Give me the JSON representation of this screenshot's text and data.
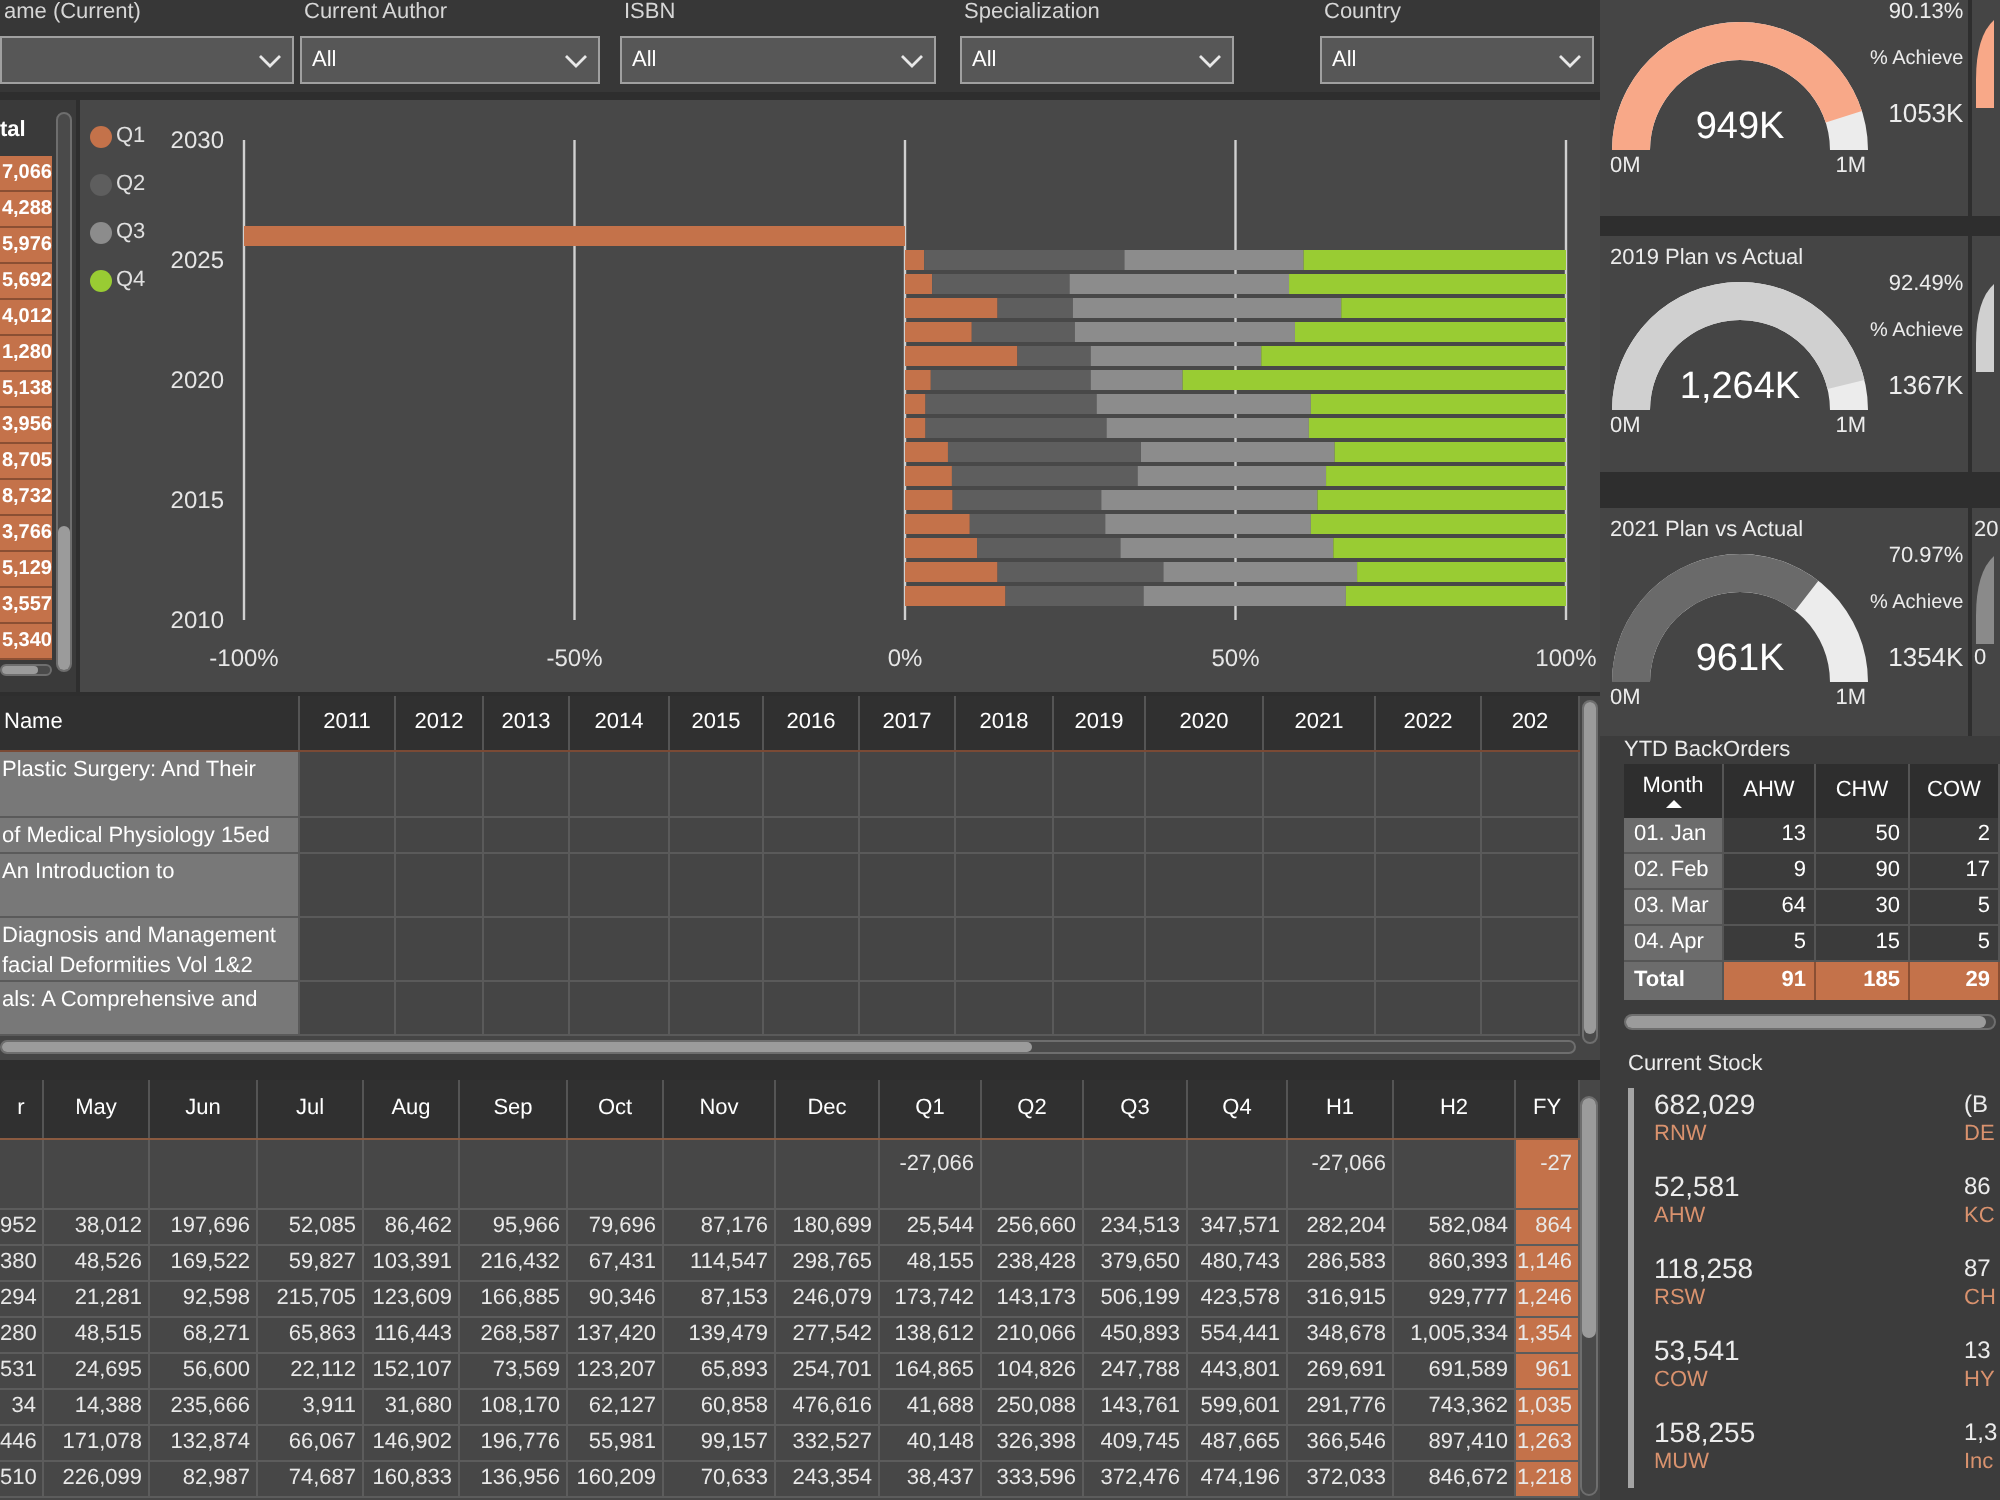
{
  "filters": [
    {
      "label": "ame (Current)"
    },
    {
      "label": "Current Author",
      "value": "All"
    },
    {
      "label": "ISBN",
      "value": "All"
    },
    {
      "label": "Specialization",
      "value": "All"
    },
    {
      "label": "Country",
      "value": "All"
    }
  ],
  "total_column": {
    "header": "tal",
    "values": [
      "7,066",
      "4,288",
      "5,976",
      "5,692",
      "4,012",
      "1,280",
      "5,138",
      "3,956",
      "8,705",
      "8,732",
      "3,766",
      "5,129",
      "3,557",
      "5,340"
    ]
  },
  "quarter_chart": {
    "chart_data": {
      "type": "bar",
      "orientation": "horizontal",
      "stacked": true,
      "grid": true,
      "x": [
        2011,
        2012,
        2013,
        2014,
        2015,
        2016,
        2017,
        2018,
        2019,
        2020,
        2021,
        2022,
        2023,
        2024,
        2025,
        2026
      ],
      "xlim": [
        -100,
        100
      ],
      "xticks": [
        {
          "value": -100,
          "label": "-100%"
        },
        {
          "value": -50,
          "label": "-50%"
        },
        {
          "value": 0,
          "label": "0%"
        },
        {
          "value": 50,
          "label": "50%"
        },
        {
          "value": 100,
          "label": "100%"
        }
      ],
      "ylim": [
        2010,
        2030
      ],
      "yticks": [
        2010,
        2015,
        2020,
        2025,
        2030
      ],
      "series": [
        {
          "name": "Q1",
          "color": "#c4724a",
          "values": [
            15.2,
            14.0,
            10.9,
            9.8,
            7.2,
            7.1,
            6.5,
            3.1,
            3.1,
            3.9,
            17.0,
            10.1,
            14.0,
            4.1,
            2.9,
            -100
          ]
        },
        {
          "name": "Q2",
          "color": "#5e5e5e",
          "values": [
            20.9,
            25.1,
            21.7,
            20.5,
            22.5,
            28.1,
            29.2,
            27.4,
            25.9,
            24.2,
            11.1,
            15.6,
            11.4,
            20.8,
            30.3,
            null
          ]
        },
        {
          "name": "Q3",
          "color": "#8c8c8c",
          "values": [
            30.6,
            29.3,
            32.2,
            31.1,
            32.7,
            28.5,
            29.3,
            30.6,
            32.4,
            13.9,
            25.8,
            33.3,
            40.6,
            33.2,
            27.1,
            null
          ]
        },
        {
          "name": "Q4",
          "color": "#99cc33",
          "values": [
            33.3,
            31.6,
            35.2,
            38.6,
            37.6,
            36.3,
            35.0,
            38.9,
            38.6,
            58.0,
            46.1,
            41.0,
            34.0,
            41.9,
            39.7,
            null
          ]
        }
      ]
    }
  },
  "gauges": [
    {
      "percent": "90.13%",
      "percent_label": "% Achieve",
      "value": "949K",
      "target": "1053K",
      "min": "0M",
      "max": "1M",
      "color": "#f8a888"
    },
    {
      "title": "2019 Plan vs Actual",
      "percent": "92.49%",
      "percent_label": "% Achieve",
      "value": "1,264K",
      "target": "1367K",
      "min": "0M",
      "max": "1M",
      "color": "#d0d0d0"
    },
    {
      "title": "2021 Plan vs Actual",
      "percent": "70.97%",
      "percent_label": "% Achieve",
      "value": "961K",
      "target": "1354K",
      "min": "0M",
      "max": "1M",
      "color": "#6a6a6a"
    }
  ],
  "edge_panels": [
    {
      "kind": "gauge",
      "color": "#f8a888"
    },
    {
      "kind": "gauge",
      "color": "#d0d0d0"
    },
    {
      "kind": "gauge",
      "title": "20",
      "min": "0",
      "color": "#8a8a8a"
    }
  ],
  "books_table": {
    "columns": [
      "Name",
      "2011",
      "2012",
      "2013",
      "2014",
      "2015",
      "2016",
      "2017",
      "2018",
      "2019",
      "2020",
      "2021",
      "2022",
      "202"
    ],
    "rows": [
      {
        "lines": [
          "Plastic Surgery: And Their"
        ]
      },
      {
        "lines": [
          "of Medical Physiology 15ed"
        ]
      },
      {
        "lines": [
          "An Introduction to"
        ]
      },
      {
        "lines": [
          "Diagnosis and Management",
          "facial Deformities Vol 1&2"
        ]
      },
      {
        "lines": [
          "als: A Comprehensive and"
        ]
      }
    ]
  },
  "monthly_table": {
    "columns": [
      "r",
      "May",
      "Jun",
      "Jul",
      "Aug",
      "Sep",
      "Oct",
      "Nov",
      "Dec",
      "Q1",
      "Q2",
      "Q3",
      "Q4",
      "H1",
      "H2",
      "FY"
    ],
    "rows": [
      {
        "cells": [
          null,
          null,
          null,
          null,
          null,
          null,
          null,
          null,
          null,
          "-27,066",
          null,
          null,
          null,
          "-27,066",
          null,
          "-27"
        ]
      },
      {
        "cells": [
          "952",
          "38,012",
          "197,696",
          "52,085",
          "86,462",
          "95,966",
          "79,696",
          "87,176",
          "180,699",
          "25,544",
          "256,660",
          "234,513",
          "347,571",
          "282,204",
          "582,084",
          "864"
        ]
      },
      {
        "cells": [
          "380",
          "48,526",
          "169,522",
          "59,827",
          "103,391",
          "216,432",
          "67,431",
          "114,547",
          "298,765",
          "48,155",
          "238,428",
          "379,650",
          "480,743",
          "286,583",
          "860,393",
          "1,146"
        ]
      },
      {
        "cells": [
          "294",
          "21,281",
          "92,598",
          "215,705",
          "123,609",
          "166,885",
          "90,346",
          "87,153",
          "246,079",
          "173,742",
          "143,173",
          "506,199",
          "423,578",
          "316,915",
          "929,777",
          "1,246"
        ]
      },
      {
        "cells": [
          "280",
          "48,515",
          "68,271",
          "65,863",
          "116,443",
          "268,587",
          "137,420",
          "139,479",
          "277,542",
          "138,612",
          "210,066",
          "450,893",
          "554,441",
          "348,678",
          "1,005,334",
          "1,354"
        ]
      },
      {
        "cells": [
          "531",
          "24,695",
          "56,600",
          "22,112",
          "152,107",
          "73,569",
          "123,207",
          "65,893",
          "254,701",
          "164,865",
          "104,826",
          "247,788",
          "443,801",
          "269,691",
          "691,589",
          "961"
        ]
      },
      {
        "cells": [
          "34",
          "14,388",
          "235,666",
          "3,911",
          "31,680",
          "108,170",
          "62,127",
          "60,858",
          "476,616",
          "41,688",
          "250,088",
          "143,761",
          "599,601",
          "291,776",
          "743,362",
          "1,035"
        ]
      },
      {
        "cells": [
          "446",
          "171,078",
          "132,874",
          "66,067",
          "146,902",
          "196,776",
          "55,981",
          "99,157",
          "332,527",
          "40,148",
          "326,398",
          "409,745",
          "487,665",
          "366,546",
          "897,410",
          "1,263"
        ]
      },
      {
        "cells": [
          "510",
          "226,099",
          "82,987",
          "74,687",
          "160,833",
          "136,956",
          "160,209",
          "70,633",
          "243,354",
          "38,437",
          "333,596",
          "372,476",
          "474,196",
          "372,033",
          "846,672",
          "1,218"
        ]
      }
    ]
  },
  "backorders": {
    "title": "YTD BackOrders",
    "columns": [
      {
        "label": "Month",
        "sorted": true
      },
      {
        "label": "AHW",
        "sorted": false
      },
      {
        "label": "CHW",
        "sorted": false
      },
      {
        "label": "COW",
        "sorted": false
      }
    ],
    "rows": [
      {
        "month": "01. Jan",
        "cells": [
          "13",
          "50",
          "2"
        ]
      },
      {
        "month": "02. Feb",
        "cells": [
          "9",
          "90",
          "17"
        ]
      },
      {
        "month": "03. Mar",
        "cells": [
          "64",
          "30",
          "5"
        ]
      },
      {
        "month": "04. Apr",
        "cells": [
          "5",
          "15",
          "5"
        ]
      }
    ],
    "total": {
      "label": "Total",
      "cells": [
        "91",
        "185",
        "29"
      ]
    }
  },
  "current_stock": {
    "title": "Current Stock",
    "columns": [
      [
        {
          "value": "682,029",
          "label": "RNW"
        },
        {
          "value": "52,581",
          "label": "AHW"
        },
        {
          "value": "118,258",
          "label": "RSW"
        },
        {
          "value": "53,541",
          "label": "COW"
        },
        {
          "value": "158,255",
          "label": "MUW"
        }
      ],
      [
        {
          "value": "(B",
          "label": "DE"
        },
        {
          "value": "86",
          "label": "KC"
        },
        {
          "value": "87",
          "label": "CH"
        },
        {
          "value": "13",
          "label": "HY"
        },
        {
          "value": "1,3",
          "label": "Inc"
        }
      ]
    ]
  }
}
